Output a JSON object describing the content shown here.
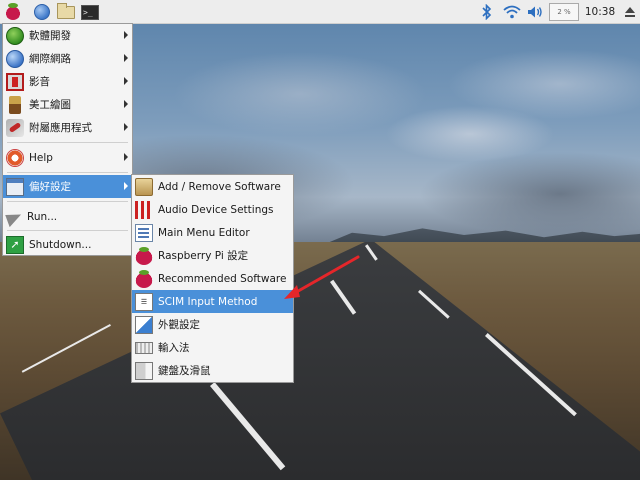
{
  "panel": {
    "launchers": [
      {
        "name": "menu-button",
        "icon": "raspberry-pi-icon"
      },
      {
        "name": "browser-launcher",
        "icon": "globe-icon"
      },
      {
        "name": "file-manager-launcher",
        "icon": "folder-icon"
      },
      {
        "name": "terminal-launcher",
        "icon": "terminal-icon",
        "glyph": ">_"
      }
    ],
    "tray": {
      "bluetooth_icon": "bluetooth-icon",
      "wifi_icon": "wifi-icon",
      "volume_icon": "volume-icon",
      "cpu_label": "2 %",
      "clock": "10:38",
      "eject_icon": "eject-icon"
    }
  },
  "main_menu": {
    "items": [
      {
        "label": "軟體開發",
        "icon": "programming-icon",
        "submenu": true
      },
      {
        "label": "網際網路",
        "icon": "internet-icon",
        "submenu": true
      },
      {
        "label": "影音",
        "icon": "sound-video-icon",
        "submenu": true
      },
      {
        "label": "美工繪圖",
        "icon": "graphics-icon",
        "submenu": true
      },
      {
        "label": "附屬應用程式",
        "icon": "accessories-icon",
        "submenu": true
      },
      {
        "label": "Help",
        "icon": "help-icon",
        "submenu": true
      },
      {
        "label": "偏好設定",
        "icon": "preferences-icon",
        "submenu": true,
        "active": true
      },
      {
        "label": "Run...",
        "icon": "run-icon",
        "submenu": false
      },
      {
        "label": "Shutdown...",
        "icon": "shutdown-icon",
        "submenu": false
      }
    ]
  },
  "sub_menu": {
    "items": [
      {
        "label": "Add / Remove Software",
        "icon": "package-icon"
      },
      {
        "label": "Audio Device Settings",
        "icon": "audio-settings-icon"
      },
      {
        "label": "Main Menu Editor",
        "icon": "menu-editor-icon"
      },
      {
        "label": "Raspberry Pi 設定",
        "icon": "raspberry-pi-icon"
      },
      {
        "label": "Recommended Software",
        "icon": "raspberry-pi-icon"
      },
      {
        "label": "SCIM Input Method",
        "icon": "scim-icon",
        "active": true
      },
      {
        "label": "外觀設定",
        "icon": "appearance-icon"
      },
      {
        "label": "輸入法",
        "icon": "keyboard-icon"
      },
      {
        "label": "鍵盤及滑鼠",
        "icon": "keyboard-mouse-icon"
      }
    ]
  },
  "colors": {
    "highlight": "#4a90d9",
    "annotation_arrow": "#e5262a",
    "panel_bg": "#ededed",
    "menu_bg": "#f4f4f4"
  }
}
